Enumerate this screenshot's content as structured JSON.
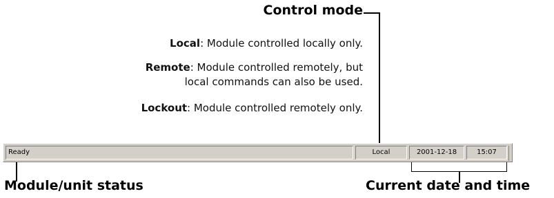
{
  "callouts": {
    "control_mode": "Control mode",
    "module_status": "Module/unit status",
    "current_datetime": "Current date and time"
  },
  "descriptions": {
    "local": {
      "term": "Local",
      "text": ": Module controlled locally only."
    },
    "remote": {
      "term": "Remote",
      "text_line1": ": Module controlled remotely, but",
      "text_line2": "local commands can also be used."
    },
    "lockout": {
      "term": "Lockout",
      "text": ": Module controlled remotely only."
    }
  },
  "status_bar": {
    "status": "Ready",
    "mode": "Local",
    "date": "2001-12-18",
    "time": "15:07"
  }
}
